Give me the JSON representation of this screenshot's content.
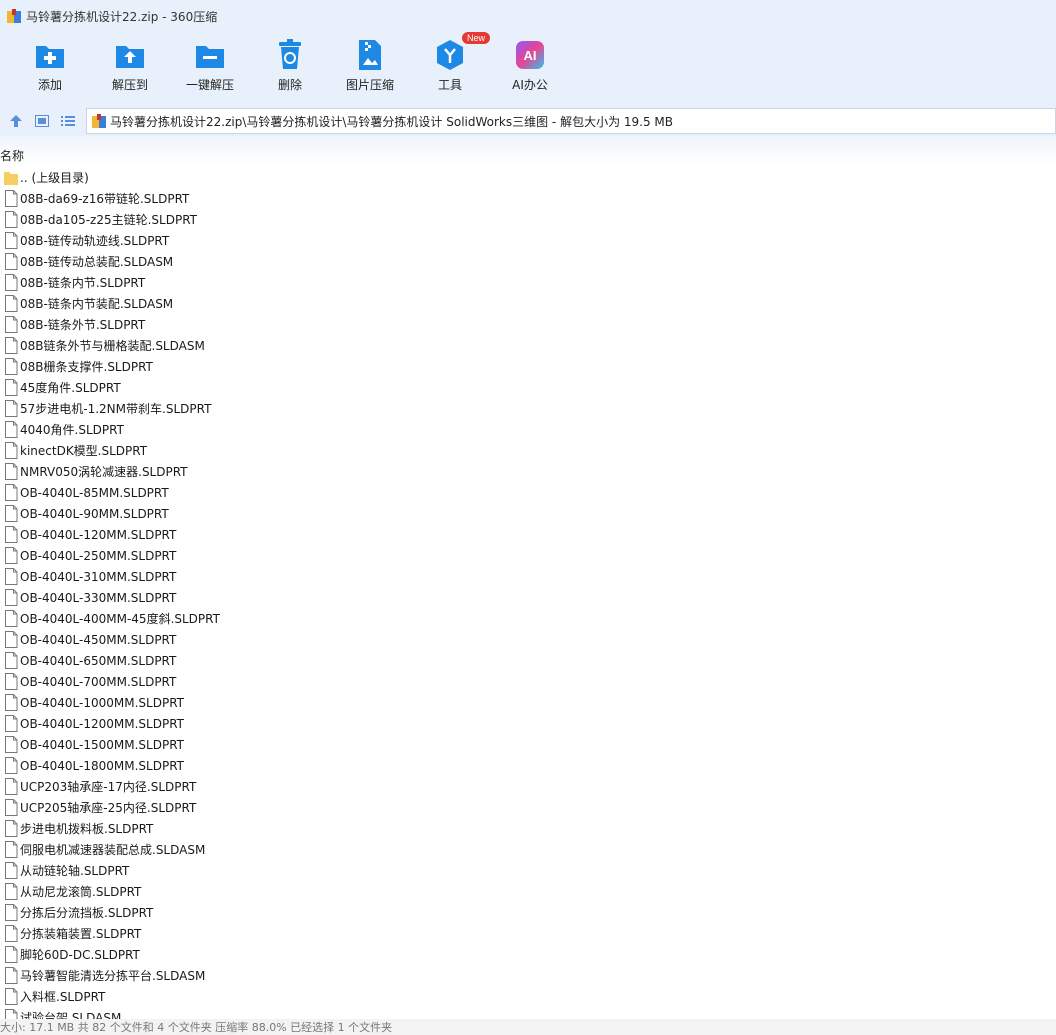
{
  "window": {
    "title": "马铃薯分拣机设计22.zip - 360压缩"
  },
  "toolbar": {
    "items": [
      {
        "label": "添加",
        "icon": "add-folder-icon"
      },
      {
        "label": "解压到",
        "icon": "extract-to-icon"
      },
      {
        "label": "一键解压",
        "icon": "one-click-extract-icon"
      },
      {
        "label": "删除",
        "icon": "trash-icon"
      },
      {
        "label": "图片压缩",
        "icon": "image-compress-icon"
      },
      {
        "label": "工具",
        "icon": "tools-icon",
        "badge": "New"
      },
      {
        "label": "AI办公",
        "icon": "ai-office-icon",
        "glyph": "AI"
      }
    ]
  },
  "path": {
    "text": "马铃薯分拣机设计22.zip\\马铃薯分拣机设计\\马铃薯分拣机设计 SolidWorks三维图 - 解包大小为 19.5 MB"
  },
  "list": {
    "header": "名称",
    "parent": ".. (上级目录)",
    "files": [
      "08B-da69-z16带链轮.SLDPRT",
      "08B-da105-z25主链轮.SLDPRT",
      "08B-链传动轨迹线.SLDPRT",
      "08B-链传动总装配.SLDASM",
      "08B-链条内节.SLDPRT",
      "08B-链条内节装配.SLDASM",
      "08B-链条外节.SLDPRT",
      "08B链条外节与栅格装配.SLDASM",
      "08B栅条支撑件.SLDPRT",
      "45度角件.SLDPRT",
      "57步进电机-1.2NM带刹车.SLDPRT",
      "4040角件.SLDPRT",
      "kinectDK模型.SLDPRT",
      "NMRV050涡轮减速器.SLDPRT",
      "OB-4040L-85MM.SLDPRT",
      "OB-4040L-90MM.SLDPRT",
      "OB-4040L-120MM.SLDPRT",
      "OB-4040L-250MM.SLDPRT",
      "OB-4040L-310MM.SLDPRT",
      "OB-4040L-330MM.SLDPRT",
      "OB-4040L-400MM-45度斜.SLDPRT",
      "OB-4040L-450MM.SLDPRT",
      "OB-4040L-650MM.SLDPRT",
      "OB-4040L-700MM.SLDPRT",
      "OB-4040L-1000MM.SLDPRT",
      "OB-4040L-1200MM.SLDPRT",
      "OB-4040L-1500MM.SLDPRT",
      "OB-4040L-1800MM.SLDPRT",
      "UCP203轴承座-17内径.SLDPRT",
      "UCP205轴承座-25内径.SLDPRT",
      "步进电机拨料板.SLDPRT",
      "伺服电机减速器装配总成.SLDASM",
      "从动链轮轴.SLDPRT",
      "从动尼龙滚筒.SLDPRT",
      "分拣后分流挡板.SLDPRT",
      "分拣装箱装置.SLDPRT",
      "脚轮60D-DC.SLDPRT",
      "马铃薯智能清选分拣平台.SLDASM",
      "入料框.SLDPRT",
      "试验台架.SLDASM"
    ]
  },
  "status": {
    "text": "大小: 17.1 MB 共 82 个文件和 4 个文件夹 压缩率 88.0% 已经选择 1 个文件夹"
  },
  "colors": {
    "chrome": "#e8f1fb",
    "accent_blue": "#1e88e5",
    "badge_red": "#e53935"
  }
}
